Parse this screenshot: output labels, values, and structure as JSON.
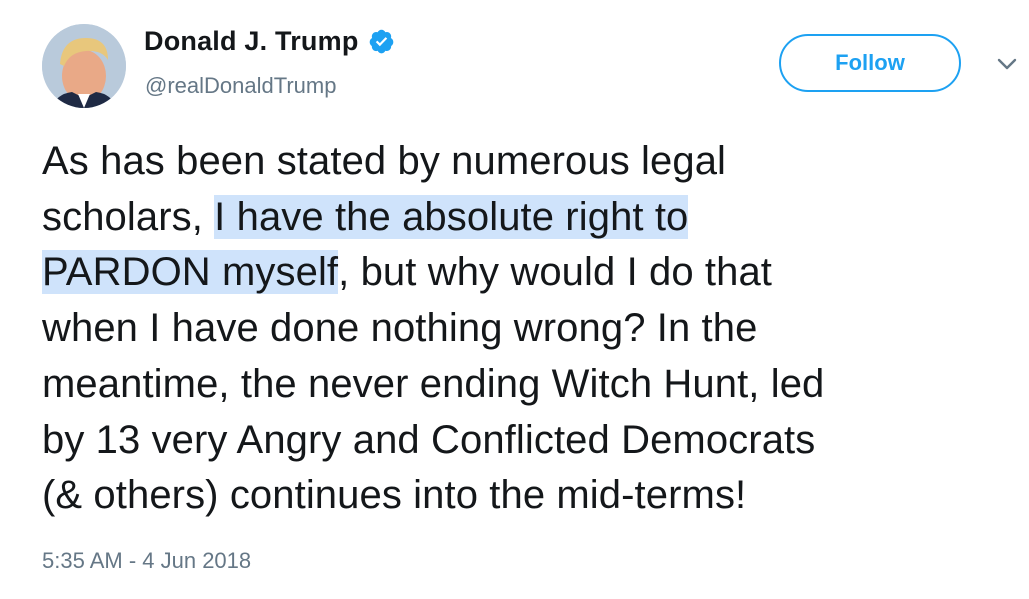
{
  "user": {
    "display_name": "Donald J. Trump",
    "handle": "@realDonaldTrump",
    "verified_icon": "verified-badge-icon",
    "avatar_icon": "profile-avatar"
  },
  "actions": {
    "follow_label": "Follow",
    "more_icon": "chevron-down-icon"
  },
  "tweet": {
    "lines": [
      {
        "text": "As has been stated by numerous legal"
      },
      {
        "pre": "scholars, ",
        "highlight": "I have the absolute right to ",
        "post": ""
      },
      {
        "pre": "",
        "highlight": "PARDON myself",
        "post": ", but why would I do that"
      },
      {
        "text": "when I have done nothing wrong? In the"
      },
      {
        "text": "meantime, the never ending Witch Hunt, led"
      },
      {
        "text": "by 13 very Angry and Conflicted Democrats"
      },
      {
        "text": "(& others) continues into the mid-terms!"
      }
    ],
    "timestamp": "5:35 AM - 4 Jun 2018"
  },
  "colors": {
    "accent": "#1da1f2",
    "secondary_text": "#657786",
    "highlight": "#cfe3fb",
    "primary_text": "#14171a"
  }
}
